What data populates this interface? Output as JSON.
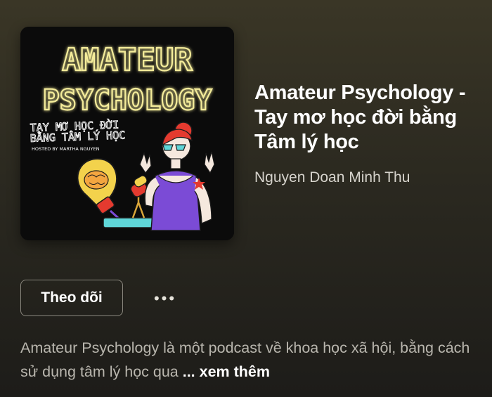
{
  "cover": {
    "title_line1": "AMATEUR",
    "title_line2": "PSYCHOLOGY",
    "subtitle_line1": "TAY MƠ HỌC ĐỜI",
    "subtitle_line2": "BẰNG TÂM LÝ HỌC",
    "hosted_by": "HOSTED BY MARTHA NGUYEN"
  },
  "podcast": {
    "title": "Amateur Psychology - Tay mơ học đời bằng Tâm lý học",
    "author": "Nguyen Doan Minh Thu"
  },
  "actions": {
    "follow_label": "Theo dõi",
    "more_label": "•••"
  },
  "description": {
    "text": "Amateur Psychology là một podcast về khoa học xã hội, bằng cách sử dụng tâm lý học qua ",
    "ellipsis": "...",
    "see_more_label": "xem thêm"
  },
  "colors": {
    "neon_yellow": "#f4ec9a",
    "neon_glow": "#e0c33a",
    "accent_red": "#e43a2f",
    "purple": "#7b4bd6",
    "cyan": "#5fd6d8"
  }
}
